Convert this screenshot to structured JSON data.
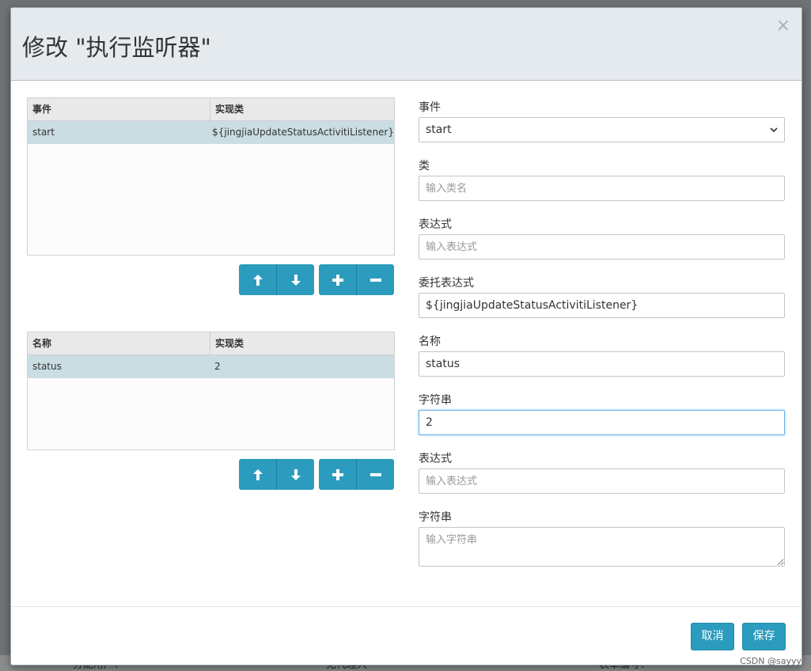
{
  "background": {
    "text_left": "分配用户：",
    "text_mid": "无代理人",
    "text_right": "表单编号："
  },
  "modal": {
    "title": "修改 \"执行监听器\"",
    "close_icon": "close-icon"
  },
  "listeners_table": {
    "columns": [
      "事件",
      "实现类"
    ],
    "rows": [
      {
        "event": "start",
        "impl": "${jingjiaUpdateStatusActivitiListener}"
      }
    ]
  },
  "fields_table": {
    "columns": [
      "名称",
      "实现类"
    ],
    "rows": [
      {
        "name": "status",
        "impl": "2"
      }
    ]
  },
  "form": {
    "event_label": "事件",
    "event_value": "start",
    "class_label": "类",
    "class_placeholder": "输入类名",
    "expression_label": "表达式",
    "expression_placeholder": "输入表达式",
    "delegate_label": "委托表达式",
    "delegate_value": "${jingjiaUpdateStatusActivitiListener}",
    "name_label": "名称",
    "name_value": "status",
    "string_label": "字符串",
    "string_value": "2",
    "field_expression_label": "表达式",
    "field_expression_placeholder": "输入表达式",
    "field_string_label": "字符串",
    "field_string_placeholder": "输入字符串"
  },
  "footer": {
    "cancel_label": "取消",
    "save_label": "保存"
  },
  "watermark": "CSDN @sayyy",
  "colors": {
    "accent": "#2b9cbd",
    "selected_row": "#c9dde2",
    "header_bg": "#e5eaee"
  }
}
